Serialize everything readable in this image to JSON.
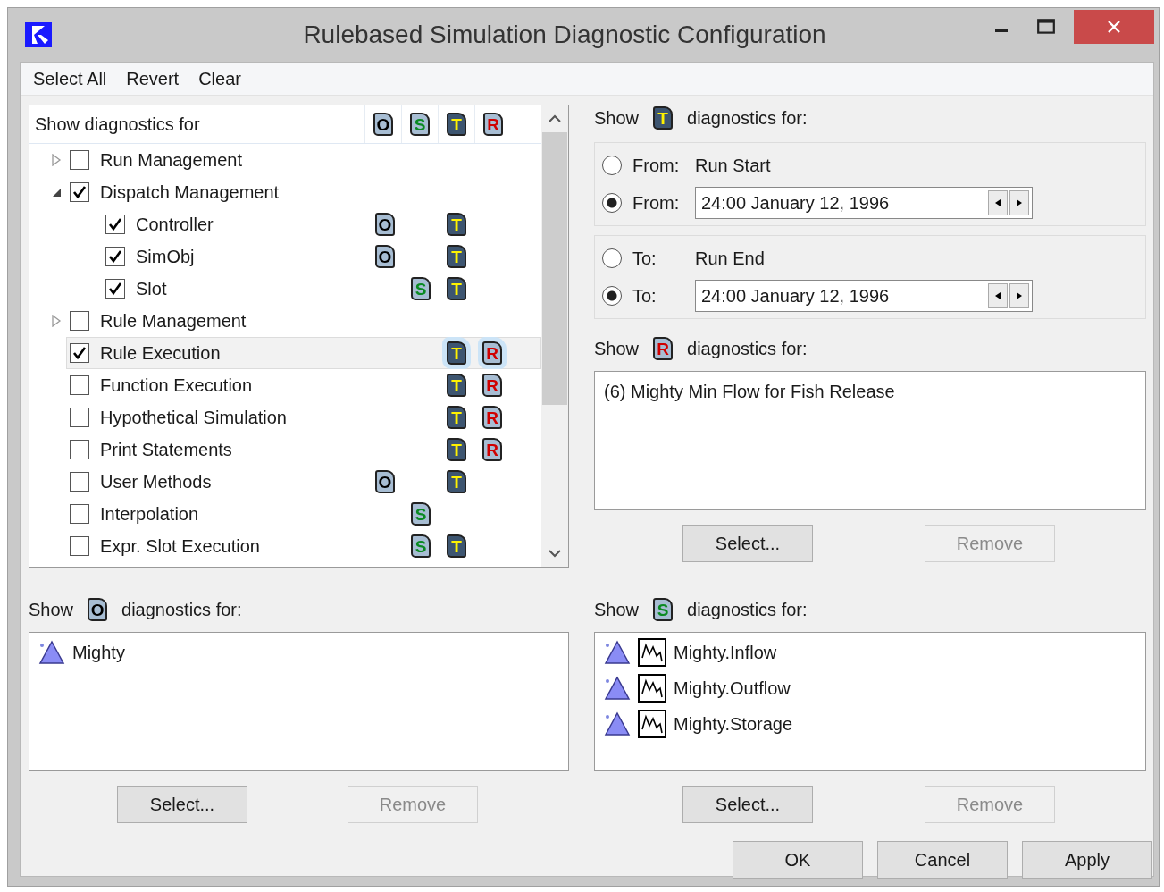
{
  "window": {
    "title": "Rulebased Simulation Diagnostic Configuration"
  },
  "toolbar": [
    "Select All",
    "Revert",
    "Clear"
  ],
  "tree": {
    "header": "Show diagnostics for",
    "columns": [
      {
        "letter": "O",
        "kind": "object"
      },
      {
        "letter": "S",
        "kind": "slot"
      },
      {
        "letter": "T",
        "kind": "trace"
      },
      {
        "letter": "R",
        "kind": "rule"
      }
    ],
    "items": [
      {
        "label": "Run Management",
        "checked": false,
        "expanded": false,
        "selected": false
      },
      {
        "label": "Dispatch Management",
        "checked": true,
        "expanded": true,
        "selected": false,
        "children": [
          {
            "label": "Controller",
            "checked": true,
            "selected": false,
            "badges": [
              {
                "letter": "O",
                "kind": "object"
              },
              {
                "letter": "T",
                "kind": "trace"
              }
            ]
          },
          {
            "label": "SimObj",
            "checked": true,
            "selected": false,
            "badges": [
              {
                "letter": "O",
                "kind": "object"
              },
              {
                "letter": "T",
                "kind": "trace"
              }
            ]
          },
          {
            "label": "Slot",
            "checked": true,
            "selected": false,
            "badges": [
              {
                "letter": "S",
                "kind": "slot"
              },
              {
                "letter": "T",
                "kind": "trace"
              }
            ]
          }
        ]
      },
      {
        "label": "Rule Management",
        "checked": false,
        "expanded": false,
        "selected": false
      },
      {
        "label": "Rule Execution",
        "checked": true,
        "selected": true,
        "badges": [
          {
            "letter": "T",
            "kind": "trace"
          },
          {
            "letter": "R",
            "kind": "rule"
          }
        ]
      },
      {
        "label": "Function Execution",
        "checked": false,
        "selected": false,
        "badges": [
          {
            "letter": "T",
            "kind": "trace"
          },
          {
            "letter": "R",
            "kind": "rule"
          }
        ]
      },
      {
        "label": "Hypothetical Simulation",
        "checked": false,
        "selected": false,
        "badges": [
          {
            "letter": "T",
            "kind": "trace"
          },
          {
            "letter": "R",
            "kind": "rule"
          }
        ]
      },
      {
        "label": "Print Statements",
        "checked": false,
        "selected": false,
        "badges": [
          {
            "letter": "T",
            "kind": "trace"
          },
          {
            "letter": "R",
            "kind": "rule"
          }
        ]
      },
      {
        "label": "User Methods",
        "checked": false,
        "selected": false,
        "badges": [
          {
            "letter": "O",
            "kind": "object"
          },
          {
            "letter": "T",
            "kind": "trace"
          }
        ]
      },
      {
        "label": "Interpolation",
        "checked": false,
        "selected": false,
        "badges": [
          {
            "letter": "S",
            "kind": "slot"
          }
        ]
      },
      {
        "label": "Expr. Slot Execution",
        "checked": false,
        "selected": false,
        "badges": [
          {
            "letter": "S",
            "kind": "slot"
          },
          {
            "letter": "T",
            "kind": "trace"
          }
        ]
      }
    ]
  },
  "trace_section": {
    "show": "Show",
    "badge": {
      "letter": "T",
      "kind": "trace"
    },
    "label": "diagnostics for:",
    "groups": [
      [
        {
          "label": "From:",
          "kind": "text",
          "value": "Run Start",
          "selected": false
        },
        {
          "label": "From:",
          "kind": "date",
          "value": "24:00 January 12, 1996",
          "selected": true
        }
      ],
      [
        {
          "label": "To:",
          "kind": "text",
          "value": "Run End",
          "selected": false
        },
        {
          "label": "To:",
          "kind": "date",
          "value": "24:00 January 12, 1996",
          "selected": true
        }
      ]
    ]
  },
  "rule_section": {
    "show": "Show",
    "badge": {
      "letter": "R",
      "kind": "rule"
    },
    "label": "diagnostics for:",
    "items": [
      {
        "label": "(6) Mighty Min Flow for Fish Release"
      }
    ],
    "buttons": [
      {
        "label": "Select...",
        "disabled": false
      },
      {
        "label": "Remove",
        "disabled": true
      }
    ]
  },
  "object_section": {
    "show": "Show",
    "badge": {
      "letter": "O",
      "kind": "object"
    },
    "label": "diagnostics for:",
    "items": [
      {
        "kind": "object",
        "label": "Mighty"
      }
    ],
    "buttons": [
      {
        "label": "Select...",
        "disabled": false
      },
      {
        "label": "Remove",
        "disabled": true
      }
    ]
  },
  "slot_section": {
    "show": "Show",
    "badge": {
      "letter": "S",
      "kind": "slot"
    },
    "label": "diagnostics for:",
    "items": [
      {
        "kind": "slot",
        "label": "Mighty.Inflow"
      },
      {
        "kind": "slot",
        "label": "Mighty.Outflow"
      },
      {
        "kind": "slot",
        "label": "Mighty.Storage"
      }
    ],
    "buttons": [
      {
        "label": "Select...",
        "disabled": false
      },
      {
        "label": "Remove",
        "disabled": true
      }
    ]
  },
  "dialog_buttons": [
    "OK",
    "Cancel",
    "Apply"
  ]
}
